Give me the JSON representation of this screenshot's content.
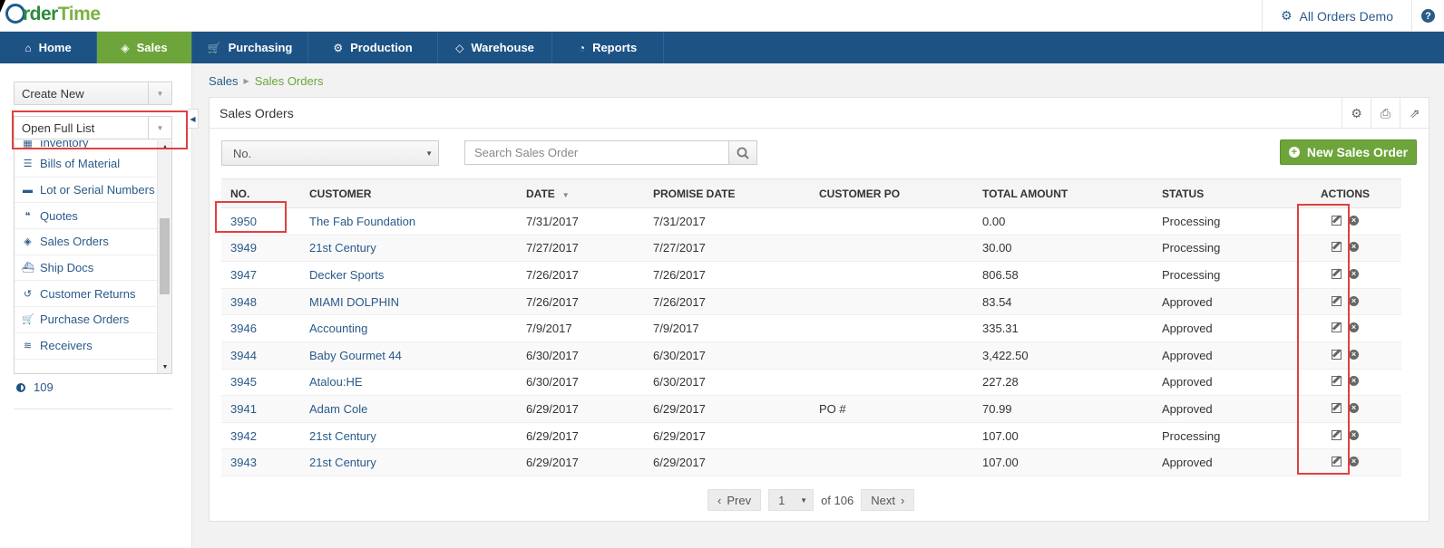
{
  "header": {
    "logo_prefix": "",
    "logo_order": "rder",
    "logo_time": "Time",
    "account_label": "All Orders Demo",
    "help_label": "?"
  },
  "nav": {
    "items": [
      {
        "label": "Home",
        "icon": "home-icon",
        "glyph": "⌂"
      },
      {
        "label": "Sales",
        "icon": "tag-icon",
        "glyph": "◈"
      },
      {
        "label": "Purchasing",
        "icon": "cart-icon",
        "glyph": "🛒"
      },
      {
        "label": "Production",
        "icon": "gears-icon",
        "glyph": "⚙"
      },
      {
        "label": "Warehouse",
        "icon": "box-icon",
        "glyph": "◇"
      },
      {
        "label": "Reports",
        "icon": "pie-chart-icon",
        "glyph": "◔"
      }
    ],
    "active": "Sales"
  },
  "sidebar": {
    "create_new_label": "Create New",
    "open_full_list_label": "Open Full List",
    "items": [
      {
        "label": "Inventory",
        "icon": "cubes-icon",
        "glyph": "▦"
      },
      {
        "label": "Bills of Material",
        "icon": "list-icon",
        "glyph": "☰"
      },
      {
        "label": "Lot or Serial Numbers",
        "icon": "barcode-icon",
        "glyph": "▬"
      },
      {
        "label": "Quotes",
        "icon": "quote-icon",
        "glyph": "❝"
      },
      {
        "label": "Sales Orders",
        "icon": "tag-icon",
        "glyph": "◈"
      },
      {
        "label": "Ship Docs",
        "icon": "ship-icon",
        "glyph": "⛴"
      },
      {
        "label": "Customer Returns",
        "icon": "undo-icon",
        "glyph": "↺"
      },
      {
        "label": "Purchase Orders",
        "icon": "cart-icon",
        "glyph": "🛒"
      },
      {
        "label": "Receivers",
        "icon": "wifi-icon",
        "glyph": "≋"
      }
    ],
    "count": "109"
  },
  "breadcrumb": {
    "root": "Sales",
    "current": "Sales Orders"
  },
  "panel": {
    "title": "Sales Orders",
    "filter_value": "No.",
    "search_placeholder": "Search Sales Order",
    "new_button_label": "New Sales Order"
  },
  "table": {
    "columns": [
      "NO.",
      "CUSTOMER",
      "DATE",
      "PROMISE DATE",
      "CUSTOMER PO",
      "TOTAL AMOUNT",
      "STATUS",
      "ACTIONS"
    ],
    "rows": [
      {
        "no": "3950",
        "customer": "The Fab Foundation",
        "date": "7/31/2017",
        "promise": "7/31/2017",
        "po": "",
        "total": "0.00",
        "status": "Processing"
      },
      {
        "no": "3949",
        "customer": "21st Century",
        "date": "7/27/2017",
        "promise": "7/27/2017",
        "po": "",
        "total": "30.00",
        "status": "Processing"
      },
      {
        "no": "3947",
        "customer": "Decker Sports",
        "date": "7/26/2017",
        "promise": "7/26/2017",
        "po": "",
        "total": "806.58",
        "status": "Processing"
      },
      {
        "no": "3948",
        "customer": "MIAMI DOLPHIN",
        "date": "7/26/2017",
        "promise": "7/26/2017",
        "po": "",
        "total": "83.54",
        "status": "Approved"
      },
      {
        "no": "3946",
        "customer": "Accounting",
        "date": "7/9/2017",
        "promise": "7/9/2017",
        "po": "",
        "total": "335.31",
        "status": "Approved"
      },
      {
        "no": "3944",
        "customer": "Baby Gourmet 44",
        "date": "6/30/2017",
        "promise": "6/30/2017",
        "po": "",
        "total": "3,422.50",
        "status": "Approved"
      },
      {
        "no": "3945",
        "customer": "Atalou:HE",
        "date": "6/30/2017",
        "promise": "6/30/2017",
        "po": "",
        "total": "227.28",
        "status": "Approved"
      },
      {
        "no": "3941",
        "customer": "Adam Cole",
        "date": "6/29/2017",
        "promise": "6/29/2017",
        "po": "PO #",
        "total": "70.99",
        "status": "Approved"
      },
      {
        "no": "3942",
        "customer": "21st Century",
        "date": "6/29/2017",
        "promise": "6/29/2017",
        "po": "",
        "total": "107.00",
        "status": "Processing"
      },
      {
        "no": "3943",
        "customer": "21st Century",
        "date": "6/29/2017",
        "promise": "6/29/2017",
        "po": "",
        "total": "107.00",
        "status": "Approved"
      }
    ]
  },
  "pager": {
    "prev_label": "Prev",
    "page": "1",
    "of_label": "of 106",
    "next_label": "Next"
  },
  "colors": {
    "nav_bg": "#1d5285",
    "accent_green": "#6da53a",
    "link_blue": "#2a5a8a",
    "highlight_red": "#e04040"
  }
}
